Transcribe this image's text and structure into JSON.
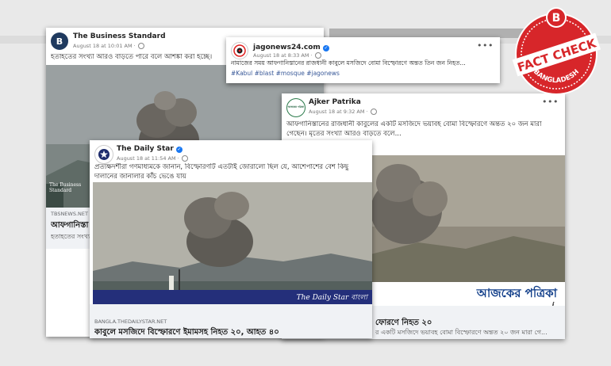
{
  "business_standard": {
    "page_name": "The Business Standard",
    "date": "August 18 at 10:01 AM",
    "caption": "হতাহতের সংখ্যা আরও বাড়তে পারে বলে আশঙ্কা করা হচ্ছে।",
    "link_domain": "TBSNEWS.NET",
    "link_title": "আফগানিস্তা",
    "link_sub": "হতাহতের সংখ্য",
    "logo_letter": "B",
    "watermark": "The Business Standard"
  },
  "jagonews": {
    "page_name": "jagonews24.com",
    "date": "August 18 at 8:33 AM",
    "caption": "নামাজের সময় আফগানিস্তানের রাজধানী কাবুলে মসজিদে বোমা বিস্ফোরণে অন্তত তিন জন নিহত...",
    "hashtags": "#Kabul #blast #mosque #jagonews"
  },
  "ajker_patrika": {
    "page_name": "Ajker Patrika",
    "date": "August 18 at 9:32 AM",
    "caption_line1": "আফগানিস্তানের রাজধানী কাবুলের একটি মসজিদে ভয়াবহ বোমা বিস্ফোরণে অন্তত ২০ জন মারা",
    "caption_line2": "গেছেন। মৃতের সংখ্যা আরও বাড়তে বলে...",
    "logo_text": "আজকের পত্রিকা",
    "link_title": "ফোরণে নিহত ২০",
    "link_sub": "র একটি মসজিদে ভয়াবহ বোমা বিস্ফোরণে অন্তত ২০ জন মারা গে..."
  },
  "daily_star": {
    "page_name": "The Daily Star",
    "date": "August 18 at 11:54 AM",
    "caption_line1": "প্রত্যক্ষদর্শীরা গণমাধ্যমকে জানান, বিস্ফোরণটি এতটাই জোরালো ছিল যে, আশেপাশের বেশ কিছু",
    "caption_line2": "দালানের জানালার কাঁচ ভেঙে যায়",
    "watermark": "The Daily Star বাংলা",
    "link_domain": "BANGLA.THEDAILYSTAR.NET",
    "link_title": "কাবুলে মসজিদে বিস্ফোরণে ইমামসহ নিহত ২০, আহত ৪০"
  },
  "badge": {
    "top": "FACT CHECK",
    "bottom": "BANGLADESH",
    "letter": "B",
    "color": "#d7262a"
  },
  "icons": {
    "more": "•••",
    "info": "i"
  }
}
